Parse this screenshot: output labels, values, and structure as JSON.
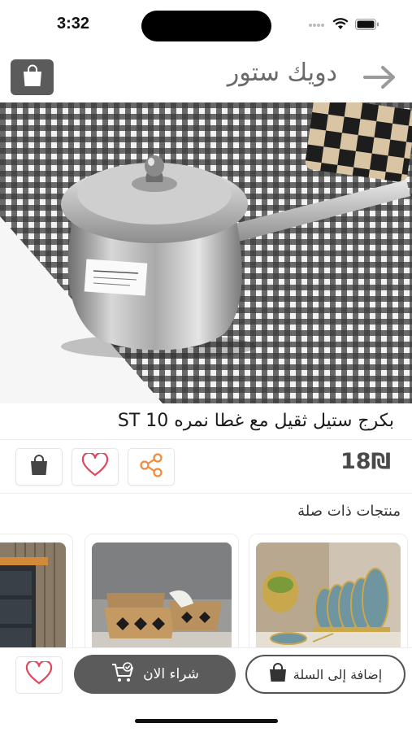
{
  "status_bar": {
    "time": "3:32"
  },
  "header": {
    "store_name": "دويك ستور",
    "cart_icon": "shopping-bag-icon",
    "back_icon": "arrow-right-icon"
  },
  "product": {
    "title": "بكرج ستيل ثقيل مع غطا نمره ST 10",
    "price": "18₪",
    "image": "product-photo-steel-coffee-pot"
  },
  "actions": {
    "cart_icon": "shopping-bag-icon",
    "favorite_icon": "heart-icon",
    "share_icon": "share-icon"
  },
  "related": {
    "heading": "منتجات ذات صلة",
    "items": [
      {
        "image": "plate-rack-product-photo"
      },
      {
        "image": "woven-baskets-product-photo"
      },
      {
        "image": "drawer-unit-product-photo"
      }
    ]
  },
  "bottom_bar": {
    "add_to_cart_label": "إضافة إلى السلة",
    "buy_now_label": "شراء الان",
    "favorite_icon": "heart-icon"
  },
  "colors": {
    "primary": "#5b5b5b",
    "favorite": "#e0455a",
    "share": "#f08a3c"
  }
}
